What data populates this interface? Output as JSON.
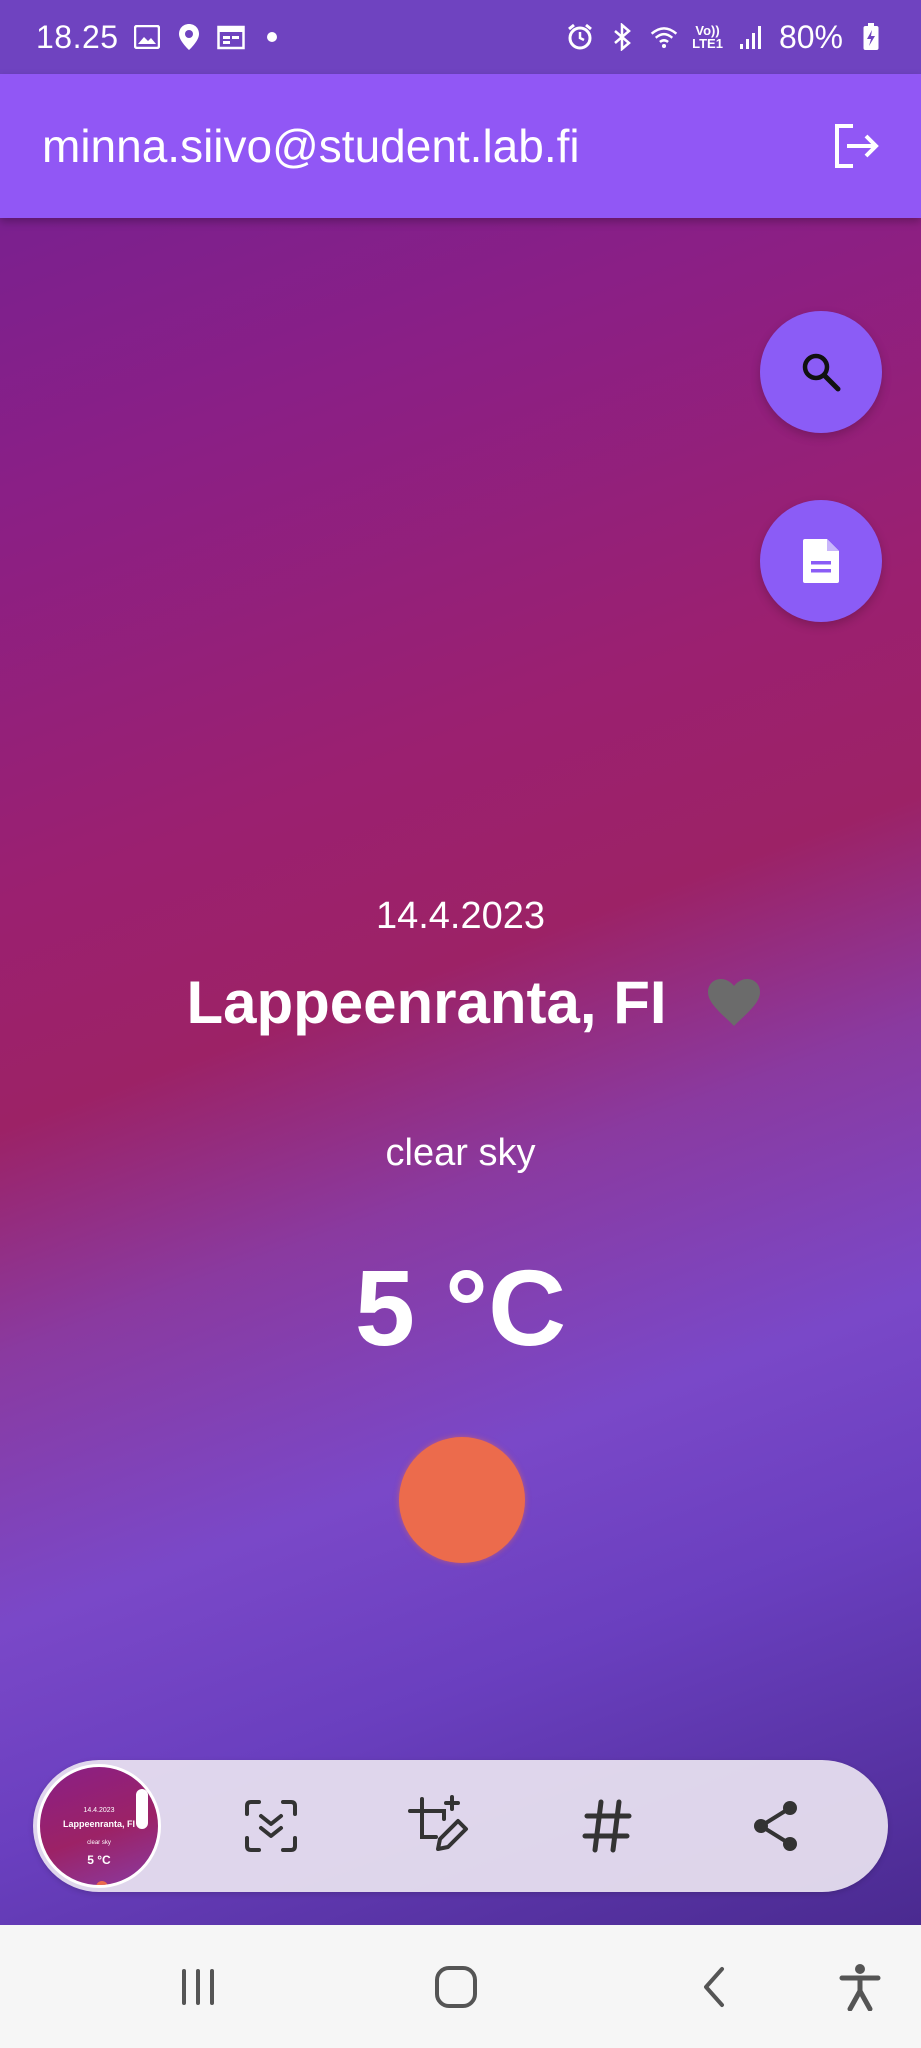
{
  "status_bar": {
    "time": "18.25",
    "battery": "80%",
    "network_label": "LTE1",
    "volte_label": "Vo))"
  },
  "app_bar": {
    "title": "minna.siivo@student.lab.fi",
    "logout_icon": "logout-icon"
  },
  "fabs": {
    "search_icon": "search-icon",
    "document_icon": "document-icon"
  },
  "weather": {
    "date": "14.4.2023",
    "city": "Lappeenranta, FI",
    "favorite_icon": "heart-icon",
    "description": "clear sky",
    "temperature": "5 °C",
    "sun_color": "#ec6b4c"
  },
  "screenshot_toolbar": {
    "thumbnail": {
      "date": "14.4.2023",
      "city": "Lappeenranta, FI",
      "description": "clear sky",
      "temperature": "5 °C"
    },
    "actions": [
      "scroll-capture-icon",
      "crop-edit-icon",
      "hashtag-icon",
      "share-icon"
    ]
  },
  "colors": {
    "app_bar": "#9157f5",
    "status_bar": "#6f43c0",
    "fab": "#8b5cf6",
    "heart": "#6b6b6b"
  }
}
